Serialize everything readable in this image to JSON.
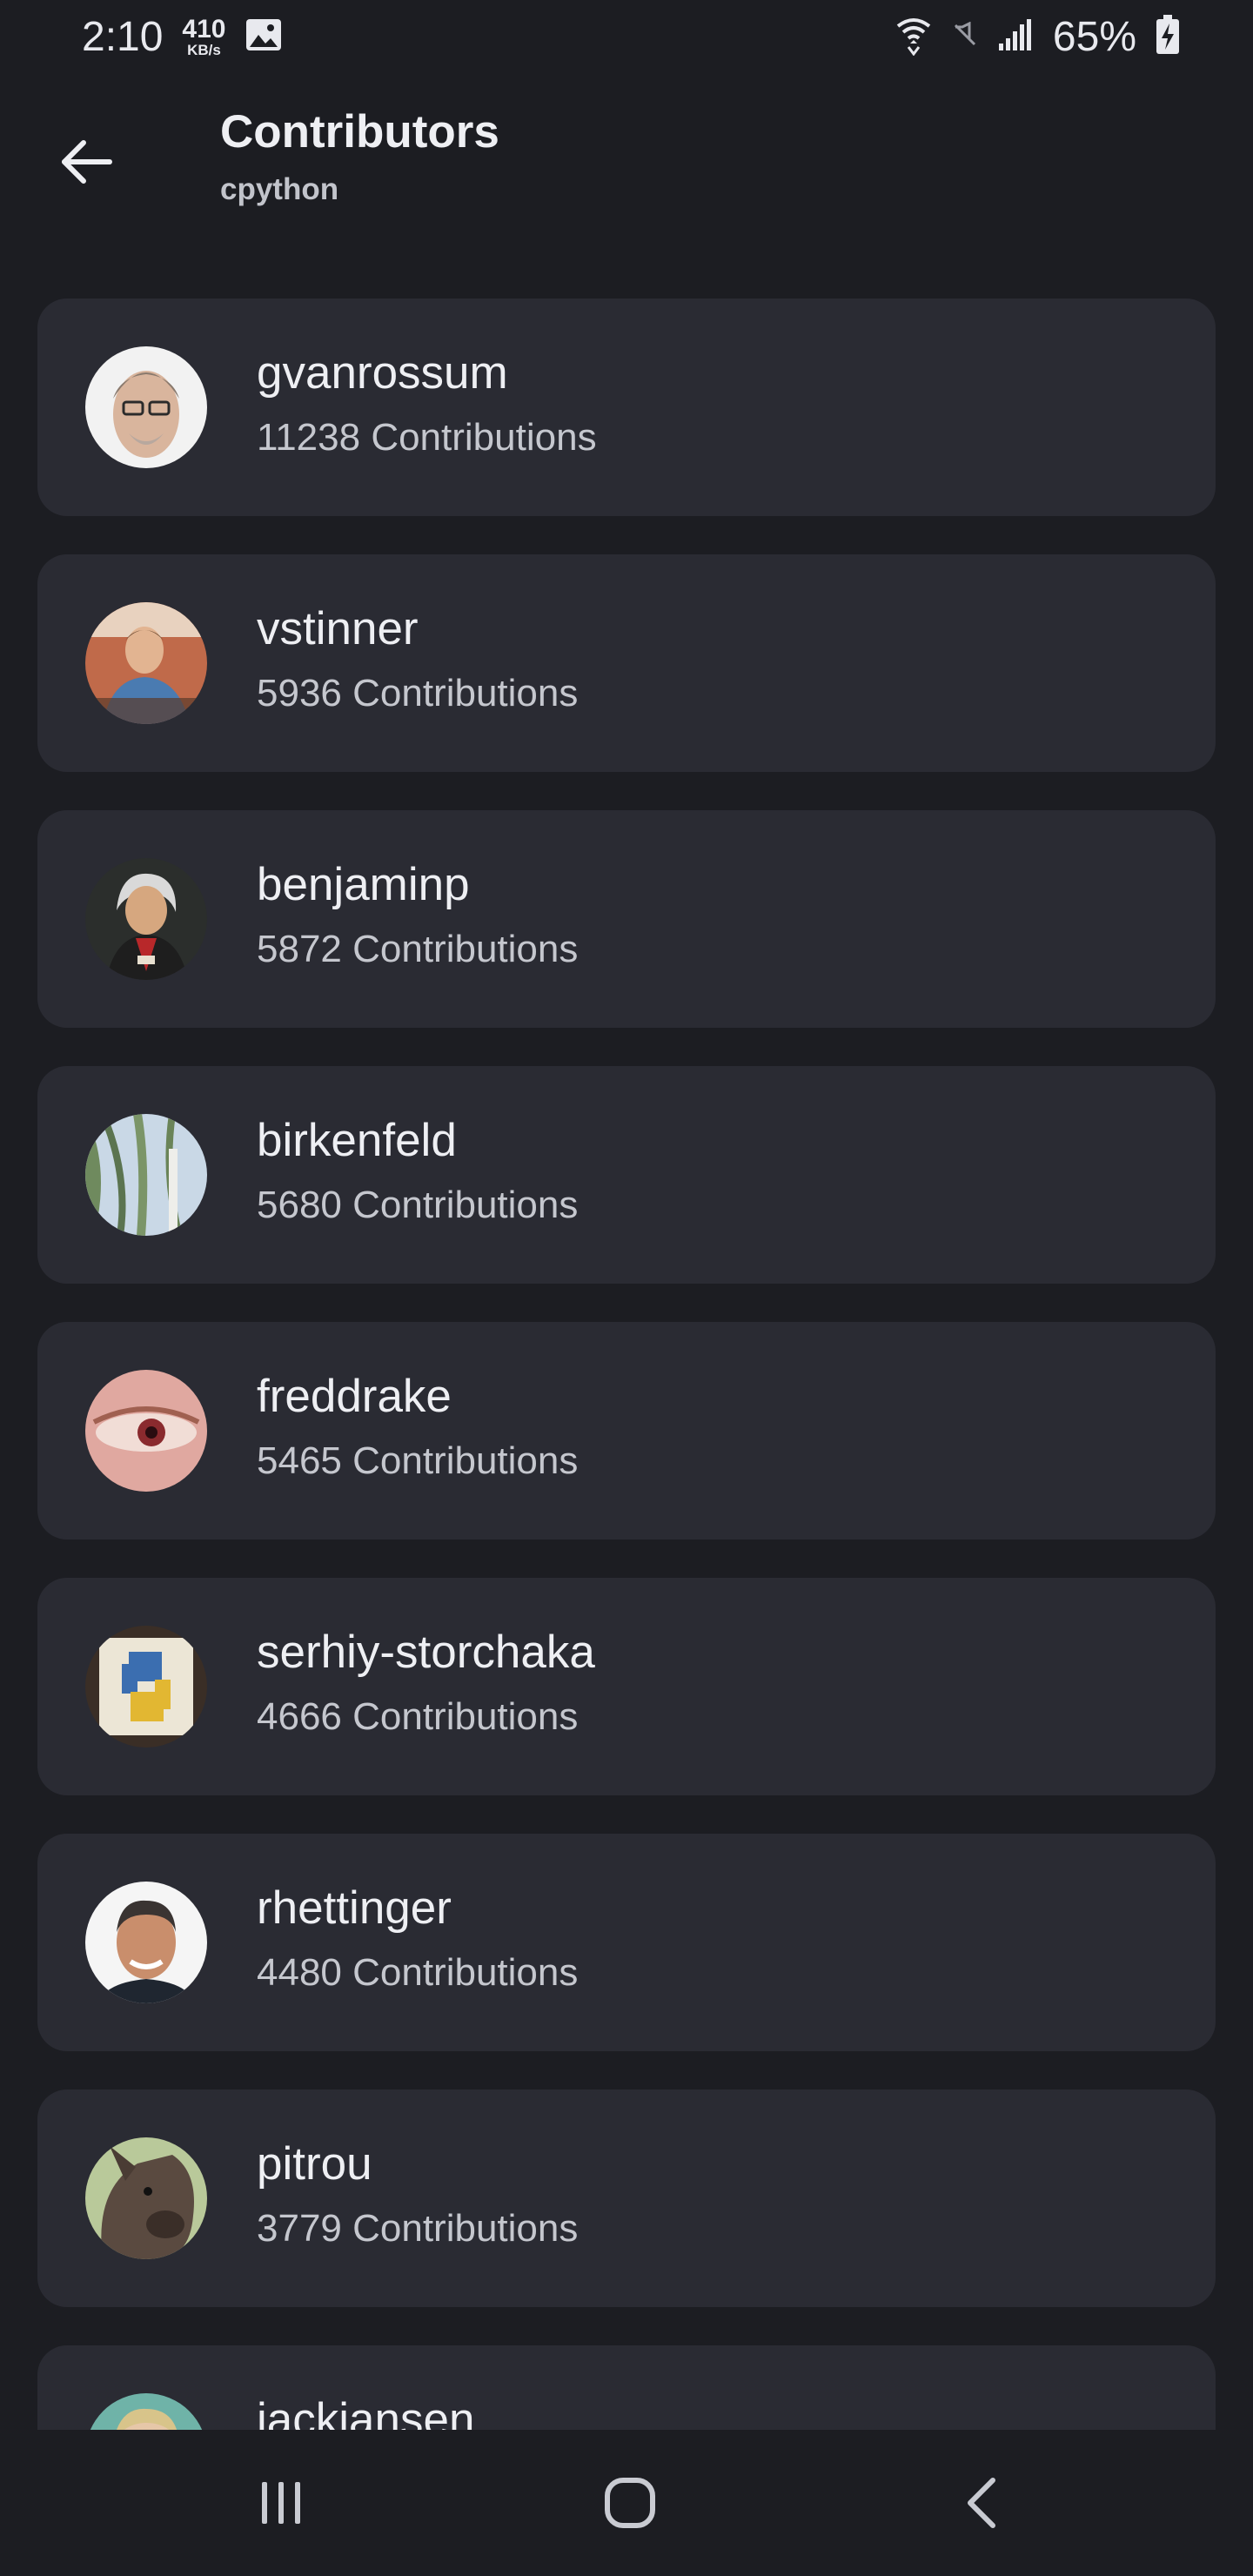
{
  "status_bar": {
    "time": "2:10",
    "net_speed": "410",
    "net_unit": "KB/s",
    "battery": "65%",
    "icons": [
      "image-icon",
      "wifi-icon",
      "mute-icon",
      "signal-icon",
      "battery-charging-icon"
    ]
  },
  "app_bar": {
    "back_icon": "arrow-left-icon",
    "title": "Contributors",
    "subtitle": "cpython"
  },
  "contributors": [
    {
      "name": "gvanrossum",
      "count": "11238 Contributions"
    },
    {
      "name": "vstinner",
      "count": "5936 Contributions"
    },
    {
      "name": "benjaminp",
      "count": "5872 Contributions"
    },
    {
      "name": "birkenfeld",
      "count": "5680 Contributions"
    },
    {
      "name": "freddrake",
      "count": "5465 Contributions"
    },
    {
      "name": "serhiy-storchaka",
      "count": "4666 Contributions"
    },
    {
      "name": "rhettinger",
      "count": "4480 Contributions"
    },
    {
      "name": "pitrou",
      "count": "3779 Contributions"
    },
    {
      "name": "jackjansen",
      "count": ""
    }
  ],
  "nav_bar": {
    "recents_icon": "recents-icon",
    "home_icon": "home-icon",
    "back_icon": "nav-back-icon"
  },
  "colors": {
    "background": "#1c1d22",
    "card": "#2a2b33",
    "text_primary": "#eeeff3",
    "text_secondary": "#c5c7ce"
  }
}
